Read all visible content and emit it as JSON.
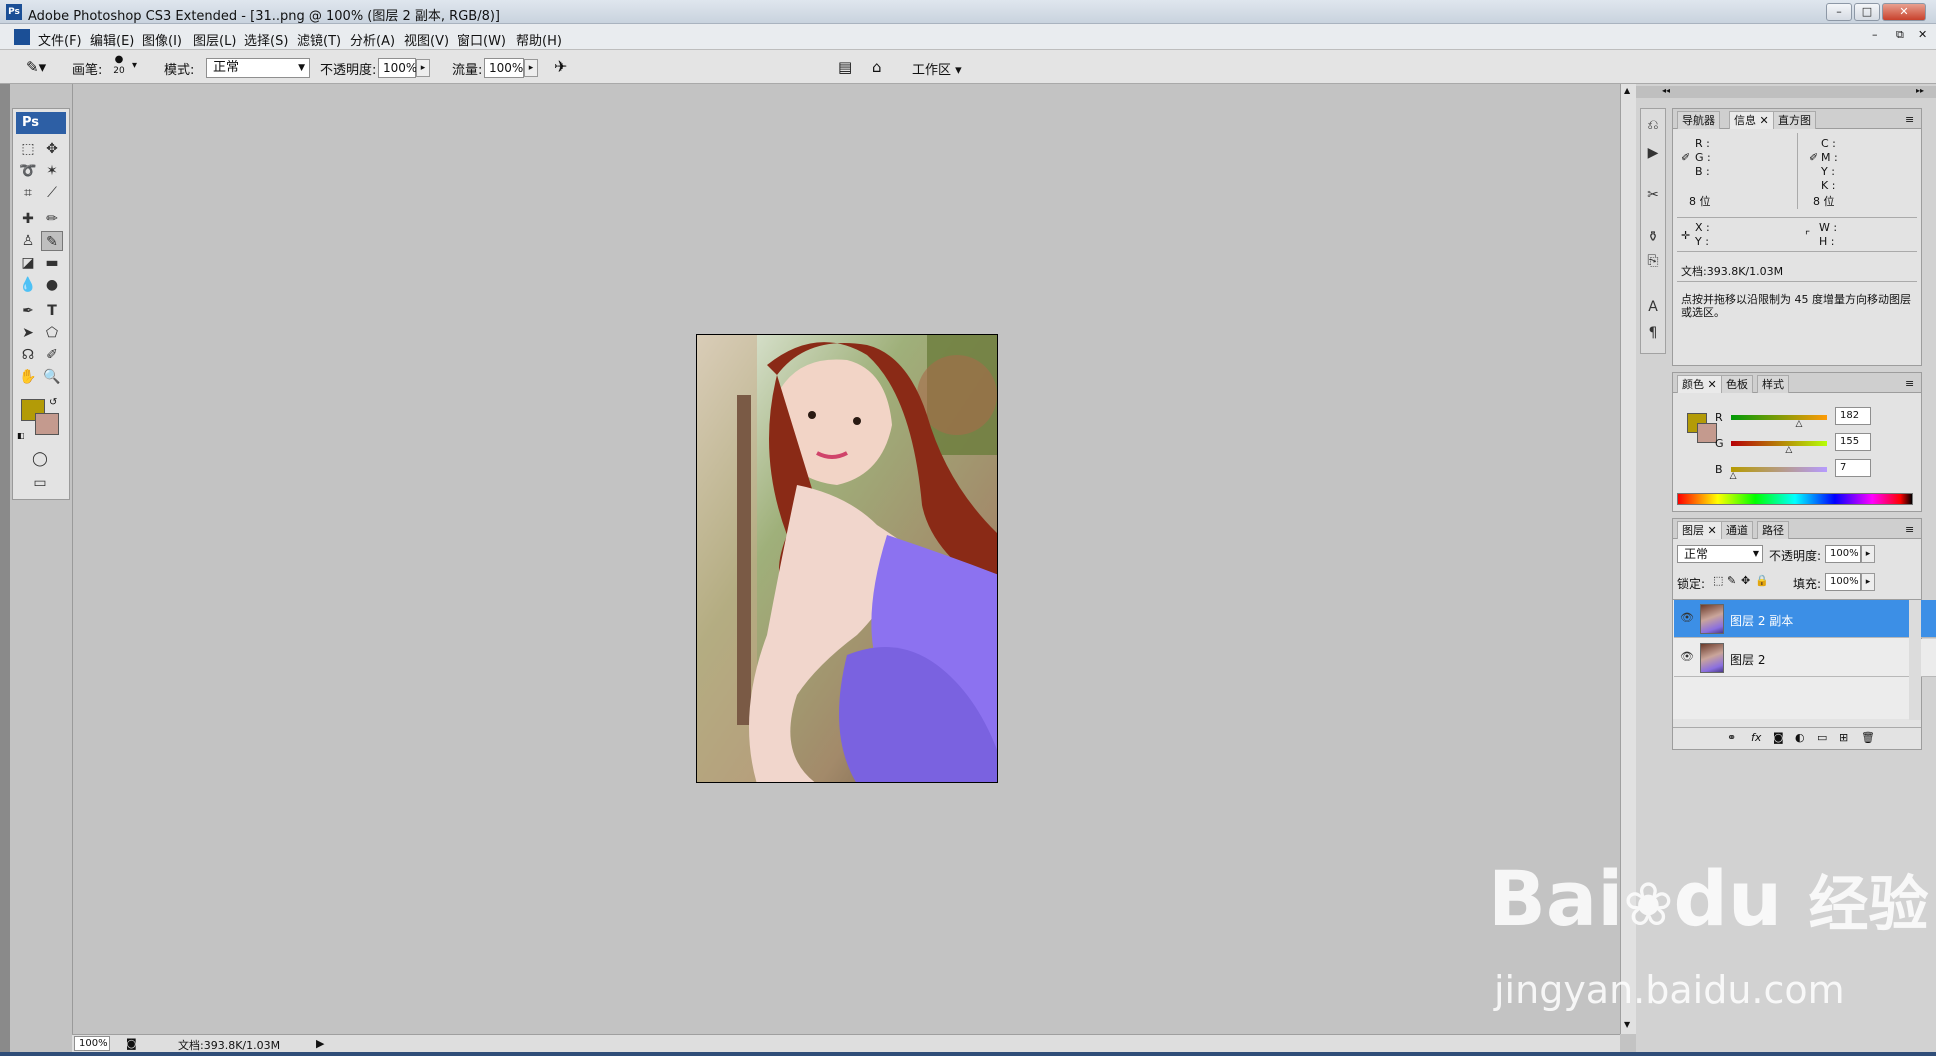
{
  "window": {
    "title": "Adobe Photoshop CS3 Extended - [31..png @ 100% (图层 2 副本, RGB/8)]",
    "min": "–",
    "max": "□",
    "close": "✕"
  },
  "menu": [
    "文件(F)",
    "编辑(E)",
    "图像(I)",
    "图层(L)",
    "选择(S)",
    "滤镜(T)",
    "分析(A)",
    "视图(V)",
    "窗口(W)",
    "帮助(H)"
  ],
  "options": {
    "brush_label": "画笔:",
    "brush_size": "20",
    "mode_label": "模式:",
    "mode_value": "正常",
    "opacity_label": "不透明度:",
    "opacity_value": "100%",
    "flow_label": "流量:",
    "flow_value": "100%",
    "workspace": "工作区 ▾"
  },
  "toolbox": {
    "logo": "Ps",
    "foreground": "#b39b07",
    "background": "#c49a8e"
  },
  "status": {
    "zoom": "100%",
    "doc": "文档:393.8K/1.03M"
  },
  "info_panel": {
    "tabs": [
      "导航器",
      "信息",
      "直方图"
    ],
    "rgb_labels": [
      "R :",
      "G :",
      "B :"
    ],
    "cmyk_labels": [
      "C :",
      "M :",
      "Y :",
      "K :"
    ],
    "bits_left": "8 位",
    "bits_right": "8 位",
    "xy_labels": [
      "X :",
      "Y :"
    ],
    "wh_labels": [
      "W :",
      "H :"
    ],
    "doc": "文档:393.8K/1.03M",
    "hint": "点按并拖移以沿限制为 45 度增量方向移动图层或选区。"
  },
  "color_panel": {
    "tabs": [
      "颜色",
      "色板",
      "样式"
    ],
    "channels": [
      {
        "label": "R",
        "value": "182",
        "level": 0.714
      },
      {
        "label": "G",
        "value": "155",
        "level": 0.608
      },
      {
        "label": "B",
        "value": "7",
        "level": 0.027
      }
    ]
  },
  "layers_panel": {
    "tabs": [
      "图层",
      "通道",
      "路径"
    ],
    "blend": "正常",
    "opacity_label": "不透明度:",
    "opacity": "100%",
    "lock_label": "锁定:",
    "fill_label": "填充:",
    "fill": "100%",
    "layers": [
      {
        "name": "图层 2 副本",
        "selected": true
      },
      {
        "name": "图层 2",
        "selected": false
      }
    ],
    "footer_icons": [
      "link-icon",
      "fx-icon",
      "mask-icon",
      "adjustment-icon",
      "group-icon",
      "new-layer-icon",
      "trash-icon"
    ]
  },
  "watermark": {
    "brand": "Bai",
    "brand2": "du",
    "cn": "经验",
    "url": "jingyan.baidu.com"
  }
}
